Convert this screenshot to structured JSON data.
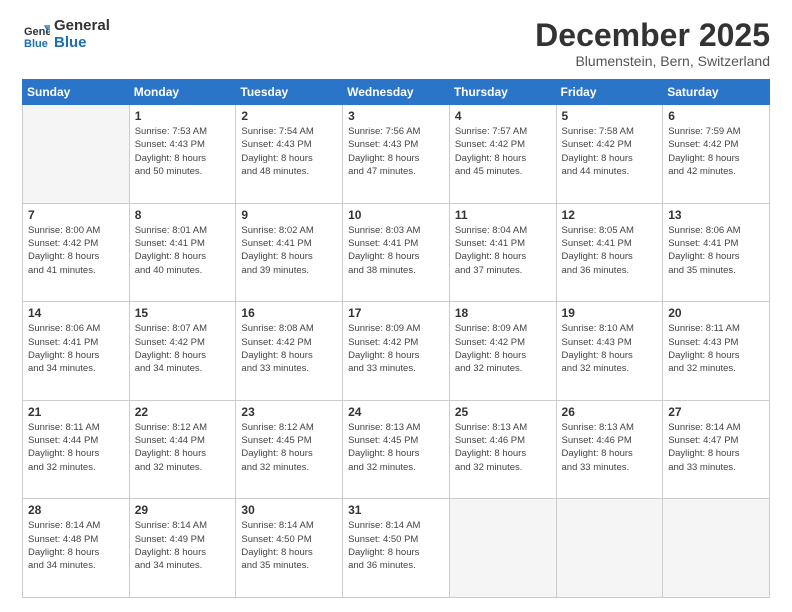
{
  "logo": {
    "general": "General",
    "blue": "Blue"
  },
  "title": {
    "month": "December 2025",
    "location": "Blumenstein, Bern, Switzerland"
  },
  "weekdays": [
    "Sunday",
    "Monday",
    "Tuesday",
    "Wednesday",
    "Thursday",
    "Friday",
    "Saturday"
  ],
  "weeks": [
    [
      {
        "day": "",
        "info": ""
      },
      {
        "day": "1",
        "info": "Sunrise: 7:53 AM\nSunset: 4:43 PM\nDaylight: 8 hours\nand 50 minutes."
      },
      {
        "day": "2",
        "info": "Sunrise: 7:54 AM\nSunset: 4:43 PM\nDaylight: 8 hours\nand 48 minutes."
      },
      {
        "day": "3",
        "info": "Sunrise: 7:56 AM\nSunset: 4:43 PM\nDaylight: 8 hours\nand 47 minutes."
      },
      {
        "day": "4",
        "info": "Sunrise: 7:57 AM\nSunset: 4:42 PM\nDaylight: 8 hours\nand 45 minutes."
      },
      {
        "day": "5",
        "info": "Sunrise: 7:58 AM\nSunset: 4:42 PM\nDaylight: 8 hours\nand 44 minutes."
      },
      {
        "day": "6",
        "info": "Sunrise: 7:59 AM\nSunset: 4:42 PM\nDaylight: 8 hours\nand 42 minutes."
      }
    ],
    [
      {
        "day": "7",
        "info": "Sunrise: 8:00 AM\nSunset: 4:42 PM\nDaylight: 8 hours\nand 41 minutes."
      },
      {
        "day": "8",
        "info": "Sunrise: 8:01 AM\nSunset: 4:41 PM\nDaylight: 8 hours\nand 40 minutes."
      },
      {
        "day": "9",
        "info": "Sunrise: 8:02 AM\nSunset: 4:41 PM\nDaylight: 8 hours\nand 39 minutes."
      },
      {
        "day": "10",
        "info": "Sunrise: 8:03 AM\nSunset: 4:41 PM\nDaylight: 8 hours\nand 38 minutes."
      },
      {
        "day": "11",
        "info": "Sunrise: 8:04 AM\nSunset: 4:41 PM\nDaylight: 8 hours\nand 37 minutes."
      },
      {
        "day": "12",
        "info": "Sunrise: 8:05 AM\nSunset: 4:41 PM\nDaylight: 8 hours\nand 36 minutes."
      },
      {
        "day": "13",
        "info": "Sunrise: 8:06 AM\nSunset: 4:41 PM\nDaylight: 8 hours\nand 35 minutes."
      }
    ],
    [
      {
        "day": "14",
        "info": "Sunrise: 8:06 AM\nSunset: 4:41 PM\nDaylight: 8 hours\nand 34 minutes."
      },
      {
        "day": "15",
        "info": "Sunrise: 8:07 AM\nSunset: 4:42 PM\nDaylight: 8 hours\nand 34 minutes."
      },
      {
        "day": "16",
        "info": "Sunrise: 8:08 AM\nSunset: 4:42 PM\nDaylight: 8 hours\nand 33 minutes."
      },
      {
        "day": "17",
        "info": "Sunrise: 8:09 AM\nSunset: 4:42 PM\nDaylight: 8 hours\nand 33 minutes."
      },
      {
        "day": "18",
        "info": "Sunrise: 8:09 AM\nSunset: 4:42 PM\nDaylight: 8 hours\nand 32 minutes."
      },
      {
        "day": "19",
        "info": "Sunrise: 8:10 AM\nSunset: 4:43 PM\nDaylight: 8 hours\nand 32 minutes."
      },
      {
        "day": "20",
        "info": "Sunrise: 8:11 AM\nSunset: 4:43 PM\nDaylight: 8 hours\nand 32 minutes."
      }
    ],
    [
      {
        "day": "21",
        "info": "Sunrise: 8:11 AM\nSunset: 4:44 PM\nDaylight: 8 hours\nand 32 minutes."
      },
      {
        "day": "22",
        "info": "Sunrise: 8:12 AM\nSunset: 4:44 PM\nDaylight: 8 hours\nand 32 minutes."
      },
      {
        "day": "23",
        "info": "Sunrise: 8:12 AM\nSunset: 4:45 PM\nDaylight: 8 hours\nand 32 minutes."
      },
      {
        "day": "24",
        "info": "Sunrise: 8:13 AM\nSunset: 4:45 PM\nDaylight: 8 hours\nand 32 minutes."
      },
      {
        "day": "25",
        "info": "Sunrise: 8:13 AM\nSunset: 4:46 PM\nDaylight: 8 hours\nand 32 minutes."
      },
      {
        "day": "26",
        "info": "Sunrise: 8:13 AM\nSunset: 4:46 PM\nDaylight: 8 hours\nand 33 minutes."
      },
      {
        "day": "27",
        "info": "Sunrise: 8:14 AM\nSunset: 4:47 PM\nDaylight: 8 hours\nand 33 minutes."
      }
    ],
    [
      {
        "day": "28",
        "info": "Sunrise: 8:14 AM\nSunset: 4:48 PM\nDaylight: 8 hours\nand 34 minutes."
      },
      {
        "day": "29",
        "info": "Sunrise: 8:14 AM\nSunset: 4:49 PM\nDaylight: 8 hours\nand 34 minutes."
      },
      {
        "day": "30",
        "info": "Sunrise: 8:14 AM\nSunset: 4:50 PM\nDaylight: 8 hours\nand 35 minutes."
      },
      {
        "day": "31",
        "info": "Sunrise: 8:14 AM\nSunset: 4:50 PM\nDaylight: 8 hours\nand 36 minutes."
      },
      {
        "day": "",
        "info": ""
      },
      {
        "day": "",
        "info": ""
      },
      {
        "day": "",
        "info": ""
      }
    ]
  ]
}
